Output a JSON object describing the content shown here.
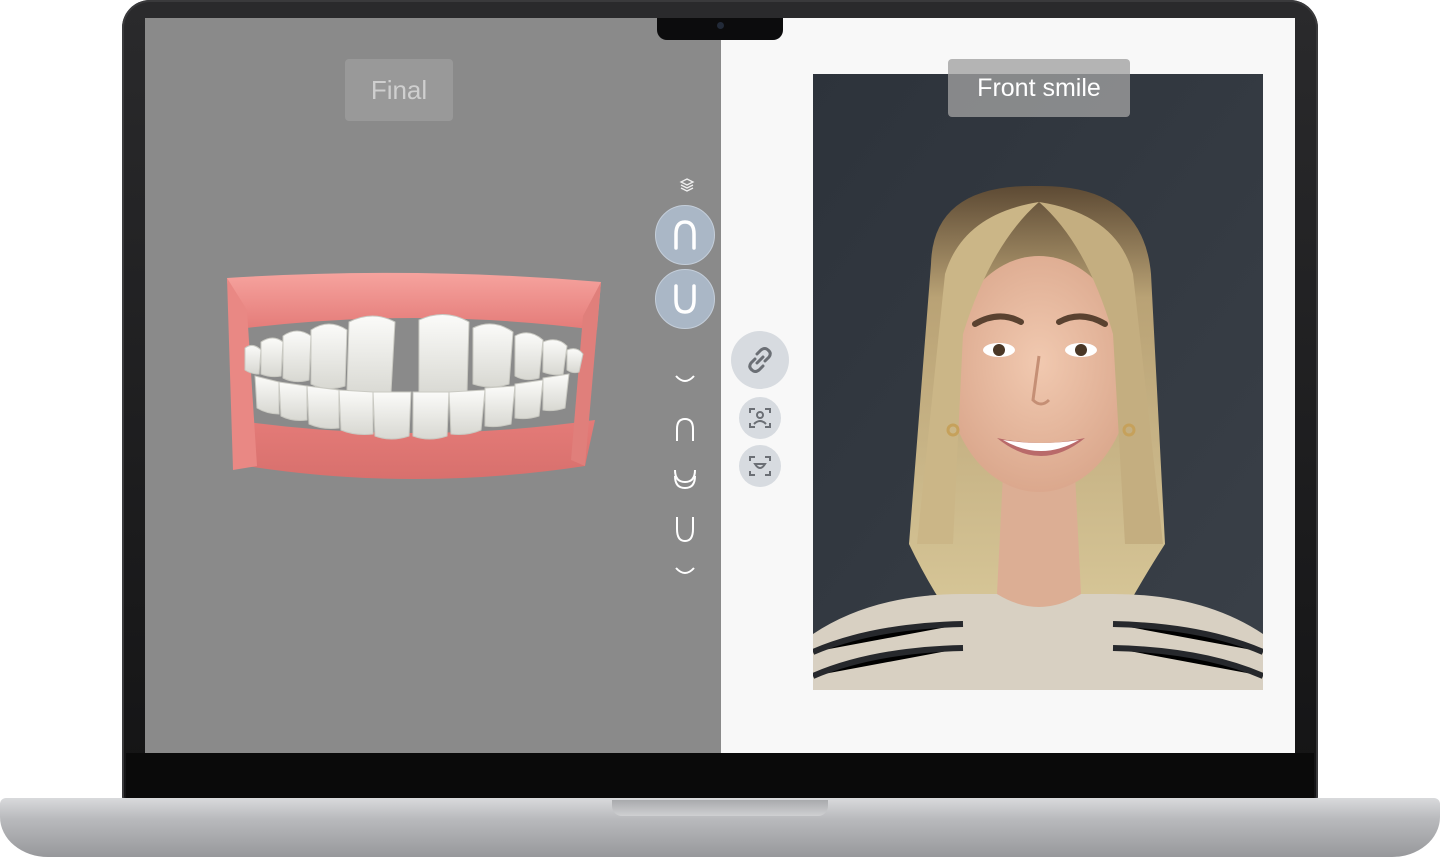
{
  "left_view": {
    "label": "Final",
    "background": "#8a8a8a",
    "rail_icons": [
      "layers-icon",
      "upper-arch-icon",
      "lower-arch-icon",
      "upper-occlusal-icon",
      "upper-arch-outline-icon",
      "bite-icon",
      "lower-arch-outline-icon",
      "lower-occlusal-icon"
    ],
    "active_buttons": [
      "upper-arch",
      "lower-arch"
    ]
  },
  "right_view": {
    "label": "Front smile",
    "side_tools": [
      "link-icon",
      "face-scan-icon",
      "smile-scan-icon"
    ]
  },
  "colors": {
    "accent_button": "#aab7c6",
    "gum": "#e88a86",
    "laptop_frame": "#1c1c1e"
  }
}
